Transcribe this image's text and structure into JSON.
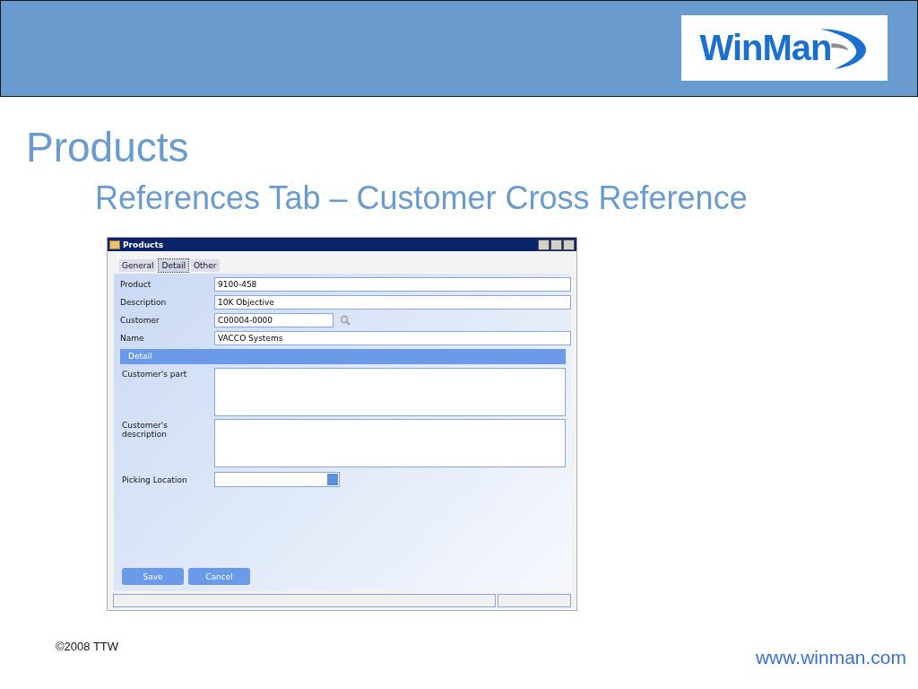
{
  "slide": {
    "logo": "WinMan",
    "title": "Products",
    "subtitle": "References Tab – Customer Cross Reference",
    "footer_left": "©2008 TTW",
    "footer_right": "www.winman.com"
  },
  "window": {
    "title": "Products",
    "tabs": [
      {
        "label": "General",
        "selected": false
      },
      {
        "label": "Detail",
        "selected": true
      },
      {
        "label": "Other",
        "selected": false
      }
    ],
    "fields": [
      {
        "label": "Product",
        "value": "9100-458",
        "kind": "text"
      },
      {
        "label": "Description",
        "value": "10K Objective",
        "kind": "text"
      },
      {
        "label": "Customer",
        "value": "C00004-0000",
        "kind": "lookup"
      },
      {
        "label": "Name",
        "value": "VACCO Systems",
        "kind": "text"
      }
    ],
    "section": "Detail",
    "detail_fields": [
      {
        "label": "Customer's part",
        "kind": "textarea"
      },
      {
        "label": "Customer's description",
        "kind": "textarea"
      },
      {
        "label": "Picking Location",
        "kind": "dropdown"
      }
    ],
    "buttons": [
      "Save",
      "Cancel"
    ]
  }
}
